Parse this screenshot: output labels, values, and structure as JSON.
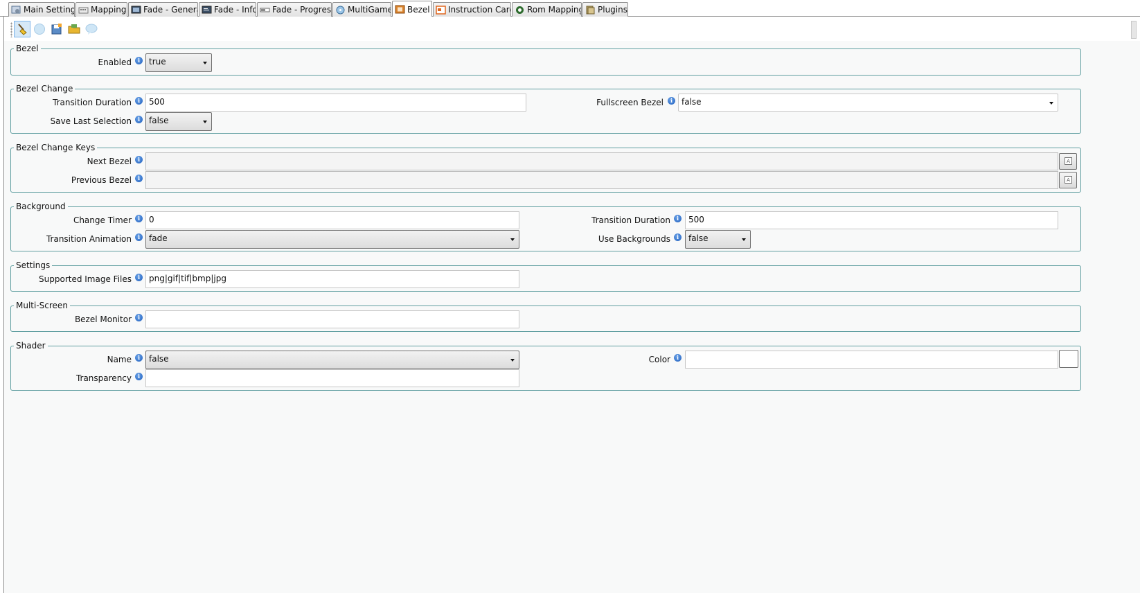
{
  "tabs": [
    {
      "label": "Main Settings",
      "icon": "gear-icon"
    },
    {
      "label": "Mapping",
      "icon": "keyboard-icon"
    },
    {
      "label": "Fade - General",
      "icon": "screen-icon"
    },
    {
      "label": "Fade - Info",
      "icon": "info-screen-icon"
    },
    {
      "label": "Fade - Progress",
      "icon": "progress-bar-icon"
    },
    {
      "label": "MultiGame",
      "icon": "disc-icon"
    },
    {
      "label": "Bezel",
      "icon": "bezel-frame-icon",
      "active": true
    },
    {
      "label": "Instruction Cards",
      "icon": "card-icon"
    },
    {
      "label": "Rom Mapping",
      "icon": "rom-icon"
    },
    {
      "label": "Plugins",
      "icon": "plugin-icon"
    }
  ],
  "toolbar": {
    "buttons": [
      "broom-icon",
      "globe-icon",
      "save-icon",
      "folder-open-icon",
      "comment-icon"
    ]
  },
  "groups": {
    "bezel": {
      "title": "Bezel",
      "enabled_label": "Enabled",
      "enabled_value": "true"
    },
    "bezel_change": {
      "title": "Bezel Change",
      "transition_duration_label": "Transition Duration",
      "transition_duration_value": "500",
      "fullscreen_bezel_label": "Fullscreen Bezel",
      "fullscreen_bezel_value": "false",
      "save_last_selection_label": "Save Last Selection",
      "save_last_selection_value": "false"
    },
    "bezel_change_keys": {
      "title": "Bezel Change Keys",
      "next_bezel_label": "Next Bezel",
      "next_bezel_value": "",
      "previous_bezel_label": "Previous Bezel",
      "previous_bezel_value": ""
    },
    "background": {
      "title": "Background",
      "change_timer_label": "Change Timer",
      "change_timer_value": "0",
      "transition_duration_label": "Transition Duration",
      "transition_duration_value": "500",
      "transition_animation_label": "Transition Animation",
      "transition_animation_value": "fade",
      "use_backgrounds_label": "Use Backgrounds",
      "use_backgrounds_value": "false"
    },
    "settings": {
      "title": "Settings",
      "supported_image_files_label": "Supported Image Files",
      "supported_image_files_value": "png|gif|tif|bmp|jpg"
    },
    "multi_screen": {
      "title": "Multi-Screen",
      "bezel_monitor_label": "Bezel Monitor",
      "bezel_monitor_value": ""
    },
    "shader": {
      "title": "Shader",
      "name_label": "Name",
      "name_value": "false",
      "color_label": "Color",
      "color_value": "",
      "transparency_label": "Transparency",
      "transparency_value": ""
    }
  },
  "info_glyph": "i",
  "colors": {
    "group_border": "#5f9ea0",
    "info_icon": "#1f5fbf",
    "tab_border": "#8c8c8c"
  }
}
